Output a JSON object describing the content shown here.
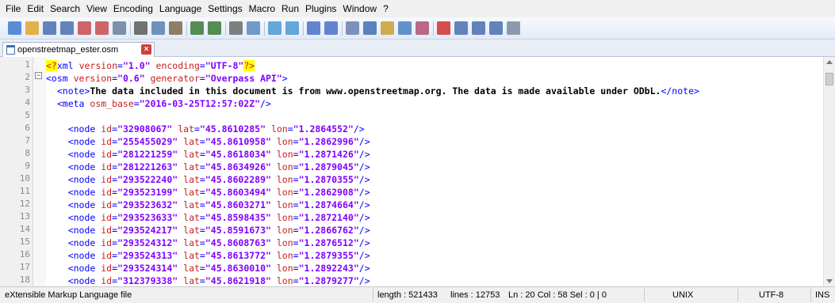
{
  "menu": [
    "File",
    "Edit",
    "Search",
    "View",
    "Encoding",
    "Language",
    "Settings",
    "Macro",
    "Run",
    "Plugins",
    "Window",
    "?"
  ],
  "toolbar": {
    "buttons": [
      "new-file-icon",
      "open-file-icon",
      "save-icon",
      "save-all-icon",
      "close-icon",
      "close-all-icon",
      "print-icon",
      "cut-icon",
      "copy-icon",
      "paste-icon",
      "undo-icon",
      "redo-icon",
      "find-icon",
      "replace-icon",
      "zoom-in-icon",
      "zoom-out-icon",
      "sync-vertical-icon",
      "sync-horizontal-icon",
      "word-wrap-icon",
      "show-all-chars-icon",
      "indent-guide-icon",
      "doc-map-icon",
      "function-list-icon",
      "record-macro-icon",
      "stop-record-icon",
      "play-macro-icon",
      "run-macro-multiple-icon",
      "save-macro-icon"
    ]
  },
  "tab": {
    "label": "openstreetmap_ester.osm"
  },
  "editor": {
    "line_numbers": [
      "1",
      "2",
      "3",
      "4",
      "5",
      "6",
      "7",
      "8",
      "9",
      "10",
      "11",
      "12",
      "13",
      "14",
      "15",
      "16",
      "17",
      "18"
    ],
    "lines": [
      {
        "segments": [
          {
            "c": "pi",
            "t": "<?"
          },
          {
            "c": "tag",
            "t": "xml "
          },
          {
            "c": "attr",
            "t": "version"
          },
          {
            "c": "tag",
            "t": "="
          },
          {
            "c": "val",
            "t": "\"1.0\""
          },
          {
            "c": "attr",
            "t": " encoding"
          },
          {
            "c": "tag",
            "t": "="
          },
          {
            "c": "val",
            "t": "\"UTF-8\""
          },
          {
            "c": "pi",
            "t": "?>"
          }
        ]
      },
      {
        "segments": [
          {
            "c": "tag",
            "t": "<osm "
          },
          {
            "c": "attr",
            "t": "version"
          },
          {
            "c": "tag",
            "t": "="
          },
          {
            "c": "val",
            "t": "\"0.6\""
          },
          {
            "c": "attr",
            "t": " generator"
          },
          {
            "c": "tag",
            "t": "="
          },
          {
            "c": "val",
            "t": "\"Overpass API\""
          },
          {
            "c": "tag",
            "t": ">"
          }
        ]
      },
      {
        "segments": [
          {
            "c": "tag",
            "t": "  <note>"
          },
          {
            "c": "txt",
            "t": "The data included in this document is from www.openstreetmap.org. The data is made available under ODbL."
          },
          {
            "c": "tag",
            "t": "</note>"
          }
        ]
      },
      {
        "segments": [
          {
            "c": "tag",
            "t": "  <meta "
          },
          {
            "c": "attr",
            "t": "osm_base"
          },
          {
            "c": "tag",
            "t": "="
          },
          {
            "c": "val",
            "t": "\"2016-03-25T12:57:02Z\""
          },
          {
            "c": "tag",
            "t": "/>"
          }
        ]
      },
      {
        "segments": []
      },
      {
        "segments": [
          {
            "c": "tag",
            "t": "    <node "
          },
          {
            "c": "attr",
            "t": "id"
          },
          {
            "c": "tag",
            "t": "="
          },
          {
            "c": "val",
            "t": "\"32908067\""
          },
          {
            "c": "attr",
            "t": " lat"
          },
          {
            "c": "tag",
            "t": "="
          },
          {
            "c": "val",
            "t": "\"45.8610285\""
          },
          {
            "c": "attr",
            "t": " lon"
          },
          {
            "c": "tag",
            "t": "="
          },
          {
            "c": "val",
            "t": "\"1.2864552\""
          },
          {
            "c": "tag",
            "t": "/>"
          }
        ]
      },
      {
        "segments": [
          {
            "c": "tag",
            "t": "    <node "
          },
          {
            "c": "attr",
            "t": "id"
          },
          {
            "c": "tag",
            "t": "="
          },
          {
            "c": "val",
            "t": "\"255455029\""
          },
          {
            "c": "attr",
            "t": " lat"
          },
          {
            "c": "tag",
            "t": "="
          },
          {
            "c": "val",
            "t": "\"45.8610958\""
          },
          {
            "c": "attr",
            "t": " lon"
          },
          {
            "c": "tag",
            "t": "="
          },
          {
            "c": "val",
            "t": "\"1.2862996\""
          },
          {
            "c": "tag",
            "t": "/>"
          }
        ]
      },
      {
        "segments": [
          {
            "c": "tag",
            "t": "    <node "
          },
          {
            "c": "attr",
            "t": "id"
          },
          {
            "c": "tag",
            "t": "="
          },
          {
            "c": "val",
            "t": "\"281221259\""
          },
          {
            "c": "attr",
            "t": " lat"
          },
          {
            "c": "tag",
            "t": "="
          },
          {
            "c": "val",
            "t": "\"45.8618034\""
          },
          {
            "c": "attr",
            "t": " lon"
          },
          {
            "c": "tag",
            "t": "="
          },
          {
            "c": "val",
            "t": "\"1.2871426\""
          },
          {
            "c": "tag",
            "t": "/>"
          }
        ]
      },
      {
        "segments": [
          {
            "c": "tag",
            "t": "    <node "
          },
          {
            "c": "attr",
            "t": "id"
          },
          {
            "c": "tag",
            "t": "="
          },
          {
            "c": "val",
            "t": "\"281221263\""
          },
          {
            "c": "attr",
            "t": " lat"
          },
          {
            "c": "tag",
            "t": "="
          },
          {
            "c": "val",
            "t": "\"45.8634926\""
          },
          {
            "c": "attr",
            "t": " lon"
          },
          {
            "c": "tag",
            "t": "="
          },
          {
            "c": "val",
            "t": "\"1.2879045\""
          },
          {
            "c": "tag",
            "t": "/>"
          }
        ]
      },
      {
        "segments": [
          {
            "c": "tag",
            "t": "    <node "
          },
          {
            "c": "attr",
            "t": "id"
          },
          {
            "c": "tag",
            "t": "="
          },
          {
            "c": "val",
            "t": "\"293522240\""
          },
          {
            "c": "attr",
            "t": " lat"
          },
          {
            "c": "tag",
            "t": "="
          },
          {
            "c": "val",
            "t": "\"45.8602289\""
          },
          {
            "c": "attr",
            "t": " lon"
          },
          {
            "c": "tag",
            "t": "="
          },
          {
            "c": "val",
            "t": "\"1.2870355\""
          },
          {
            "c": "tag",
            "t": "/>"
          }
        ]
      },
      {
        "segments": [
          {
            "c": "tag",
            "t": "    <node "
          },
          {
            "c": "attr",
            "t": "id"
          },
          {
            "c": "tag",
            "t": "="
          },
          {
            "c": "val",
            "t": "\"293523199\""
          },
          {
            "c": "attr",
            "t": " lat"
          },
          {
            "c": "tag",
            "t": "="
          },
          {
            "c": "val",
            "t": "\"45.8603494\""
          },
          {
            "c": "attr",
            "t": " lon"
          },
          {
            "c": "tag",
            "t": "="
          },
          {
            "c": "val",
            "t": "\"1.2862908\""
          },
          {
            "c": "tag",
            "t": "/>"
          }
        ]
      },
      {
        "segments": [
          {
            "c": "tag",
            "t": "    <node "
          },
          {
            "c": "attr",
            "t": "id"
          },
          {
            "c": "tag",
            "t": "="
          },
          {
            "c": "val",
            "t": "\"293523632\""
          },
          {
            "c": "attr",
            "t": " lat"
          },
          {
            "c": "tag",
            "t": "="
          },
          {
            "c": "val",
            "t": "\"45.8603271\""
          },
          {
            "c": "attr",
            "t": " lon"
          },
          {
            "c": "tag",
            "t": "="
          },
          {
            "c": "val",
            "t": "\"1.2874664\""
          },
          {
            "c": "tag",
            "t": "/>"
          }
        ]
      },
      {
        "segments": [
          {
            "c": "tag",
            "t": "    <node "
          },
          {
            "c": "attr",
            "t": "id"
          },
          {
            "c": "tag",
            "t": "="
          },
          {
            "c": "val",
            "t": "\"293523633\""
          },
          {
            "c": "attr",
            "t": " lat"
          },
          {
            "c": "tag",
            "t": "="
          },
          {
            "c": "val",
            "t": "\"45.8598435\""
          },
          {
            "c": "attr",
            "t": " lon"
          },
          {
            "c": "tag",
            "t": "="
          },
          {
            "c": "val",
            "t": "\"1.2872140\""
          },
          {
            "c": "tag",
            "t": "/>"
          }
        ]
      },
      {
        "segments": [
          {
            "c": "tag",
            "t": "    <node "
          },
          {
            "c": "attr",
            "t": "id"
          },
          {
            "c": "tag",
            "t": "="
          },
          {
            "c": "val",
            "t": "\"293524217\""
          },
          {
            "c": "attr",
            "t": " lat"
          },
          {
            "c": "tag",
            "t": "="
          },
          {
            "c": "val",
            "t": "\"45.8591673\""
          },
          {
            "c": "attr",
            "t": " lon"
          },
          {
            "c": "tag",
            "t": "="
          },
          {
            "c": "val",
            "t": "\"1.2866762\""
          },
          {
            "c": "tag",
            "t": "/>"
          }
        ]
      },
      {
        "segments": [
          {
            "c": "tag",
            "t": "    <node "
          },
          {
            "c": "attr",
            "t": "id"
          },
          {
            "c": "tag",
            "t": "="
          },
          {
            "c": "val",
            "t": "\"293524312\""
          },
          {
            "c": "attr",
            "t": " lat"
          },
          {
            "c": "tag",
            "t": "="
          },
          {
            "c": "val",
            "t": "\"45.8608763\""
          },
          {
            "c": "attr",
            "t": " lon"
          },
          {
            "c": "tag",
            "t": "="
          },
          {
            "c": "val",
            "t": "\"1.2876512\""
          },
          {
            "c": "tag",
            "t": "/>"
          }
        ]
      },
      {
        "segments": [
          {
            "c": "tag",
            "t": "    <node "
          },
          {
            "c": "attr",
            "t": "id"
          },
          {
            "c": "tag",
            "t": "="
          },
          {
            "c": "val",
            "t": "\"293524313\""
          },
          {
            "c": "attr",
            "t": " lat"
          },
          {
            "c": "tag",
            "t": "="
          },
          {
            "c": "val",
            "t": "\"45.8613772\""
          },
          {
            "c": "attr",
            "t": " lon"
          },
          {
            "c": "tag",
            "t": "="
          },
          {
            "c": "val",
            "t": "\"1.2879355\""
          },
          {
            "c": "tag",
            "t": "/>"
          }
        ]
      },
      {
        "segments": [
          {
            "c": "tag",
            "t": "    <node "
          },
          {
            "c": "attr",
            "t": "id"
          },
          {
            "c": "tag",
            "t": "="
          },
          {
            "c": "val",
            "t": "\"293524314\""
          },
          {
            "c": "attr",
            "t": " lat"
          },
          {
            "c": "tag",
            "t": "="
          },
          {
            "c": "val",
            "t": "\"45.8630010\""
          },
          {
            "c": "attr",
            "t": " lon"
          },
          {
            "c": "tag",
            "t": "="
          },
          {
            "c": "val",
            "t": "\"1.2892243\""
          },
          {
            "c": "tag",
            "t": "/>"
          }
        ]
      },
      {
        "segments": [
          {
            "c": "tag",
            "t": "    <node "
          },
          {
            "c": "attr",
            "t": "id"
          },
          {
            "c": "tag",
            "t": "="
          },
          {
            "c": "val",
            "t": "\"312379338\""
          },
          {
            "c": "attr",
            "t": " lat"
          },
          {
            "c": "tag",
            "t": "="
          },
          {
            "c": "val",
            "t": "\"45.8621918\""
          },
          {
            "c": "attr",
            "t": " lon"
          },
          {
            "c": "tag",
            "t": "="
          },
          {
            "c": "val",
            "t": "\"1.2879277\""
          },
          {
            "c": "tag",
            "t": "/>"
          }
        ]
      }
    ]
  },
  "status": {
    "file_type": "eXtensible Markup Language file",
    "length": "length : 521433",
    "lines": "lines : 12753",
    "position": "Ln : 20    Col : 58    Sel : 0 | 0",
    "eol": "UNIX",
    "encoding": "UTF-8",
    "mode": "INS"
  },
  "colors": {
    "tag": "#0000ff",
    "attr": "#c8201f",
    "value": "#8000ff",
    "pi_highlight": "#ffff00"
  }
}
